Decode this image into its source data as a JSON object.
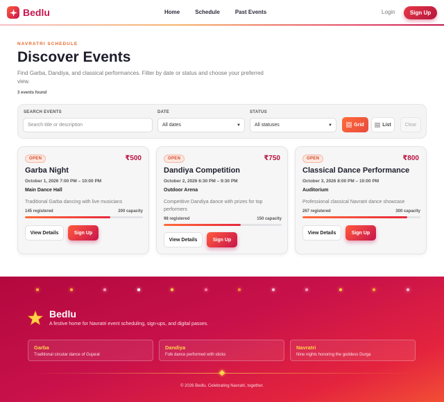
{
  "header": {
    "brand": "Bedlu",
    "nav": [
      "Home",
      "Schedule",
      "Past Events"
    ],
    "login": "Login",
    "signup": "Sign Up"
  },
  "hero": {
    "eyebrow": "NAVRATRI SCHEDULE",
    "title": "Discover Events",
    "subtitle": "Find Garba, Dandiya, and classical performances. Filter by date or status and choose your preferred view.",
    "count": "3 events found"
  },
  "filters": {
    "search_label": "SEARCH EVENTS",
    "search_placeholder": "Search title or description",
    "date_label": "DATE",
    "date_value": "All dates",
    "status_label": "STATUS",
    "status_value": "All statuses",
    "grid": "Grid",
    "list": "List",
    "clear": "Clear"
  },
  "events": [
    {
      "status": "OPEN",
      "price": "₹500",
      "title": "Garba Night",
      "date": "October 1, 2026    7:00 PM – 10:00 PM",
      "venue": "Main Dance Hall",
      "description": "Traditional Garba dancing with live musicians",
      "registered": "145 registered",
      "capacity": "200 capacity",
      "fill": 0.725,
      "details": "View Details",
      "signup": "Sign Up"
    },
    {
      "status": "OPEN",
      "price": "₹750",
      "title": "Dandiya Competition",
      "date": "October 2, 2026    6:30 PM – 9:30 PM",
      "venue": "Outdoor Arena",
      "description": "Competitive Dandiya dance with prizes for top performers",
      "registered": "98 registered",
      "capacity": "150 capacity",
      "fill": 0.653,
      "details": "View Details",
      "signup": "Sign Up"
    },
    {
      "status": "OPEN",
      "price": "₹800",
      "title": "Classical Dance Performance",
      "date": "October 3, 2026    8:00 PM – 10:00 PM",
      "venue": "Auditorium",
      "description": "Professional classical Navratri dance showcase",
      "registered": "267 registered",
      "capacity": "300 capacity",
      "fill": 0.89,
      "details": "View Details",
      "signup": "Sign Up"
    }
  ],
  "footer": {
    "brand": "Bedlu",
    "tagline": "A festive home for Navratri event scheduling, sign-ups, and digital passes.",
    "cards": [
      {
        "title": "Garba",
        "desc": "Traditional circular dance of Gujarat"
      },
      {
        "title": "Dandiya",
        "desc": "Folk dance performed with sticks"
      },
      {
        "title": "Navratri",
        "desc": "Nine nights honoring the goddess Durga"
      }
    ],
    "copyright": "© 2026 Bedlu. Celebrating Navratri, together."
  },
  "colors": {
    "accent": "#c8154d",
    "orange": "#ff6b3a",
    "gold": "#ffd24a"
  }
}
